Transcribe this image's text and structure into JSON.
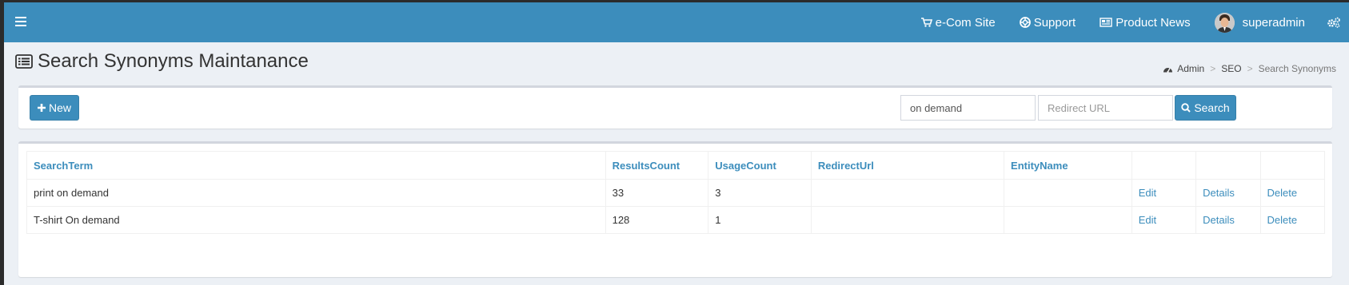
{
  "navbar": {
    "links": [
      {
        "label": "e-Com Site",
        "icon": "shopping-cart-icon"
      },
      {
        "label": "Support",
        "icon": "life-ring-icon"
      },
      {
        "label": "Product News",
        "icon": "newspaper-icon"
      }
    ],
    "user": {
      "name": "superadmin",
      "icon": "avatar"
    },
    "settings_icon": "gears-icon",
    "brand_color": "#3c8dbc"
  },
  "page": {
    "title": "Search Synonyms Maintanance",
    "title_icon": "list-alt-icon"
  },
  "breadcrumb": {
    "items": [
      "Admin",
      "SEO",
      "Search Synonyms"
    ],
    "separator": ">",
    "icon": "dashboard-icon"
  },
  "toolbar": {
    "new_label": "New",
    "search_label": "Search",
    "search_term_value": "on demand",
    "redirect_url_placeholder": "Redirect URL"
  },
  "table": {
    "headers": [
      "SearchTerm",
      "ResultsCount",
      "UsageCount",
      "RedirectUrl",
      "EntityName",
      "",
      "",
      ""
    ],
    "rows": [
      {
        "search_term": "print on demand",
        "results_count": "33",
        "usage_count": "3",
        "redirect_url": "",
        "entity_name": "",
        "edit": "Edit",
        "details": "Details",
        "delete": "Delete"
      },
      {
        "search_term": "T-shirt On demand",
        "results_count": "128",
        "usage_count": "1",
        "redirect_url": "",
        "entity_name": "",
        "edit": "Edit",
        "details": "Details",
        "delete": "Delete"
      }
    ]
  }
}
